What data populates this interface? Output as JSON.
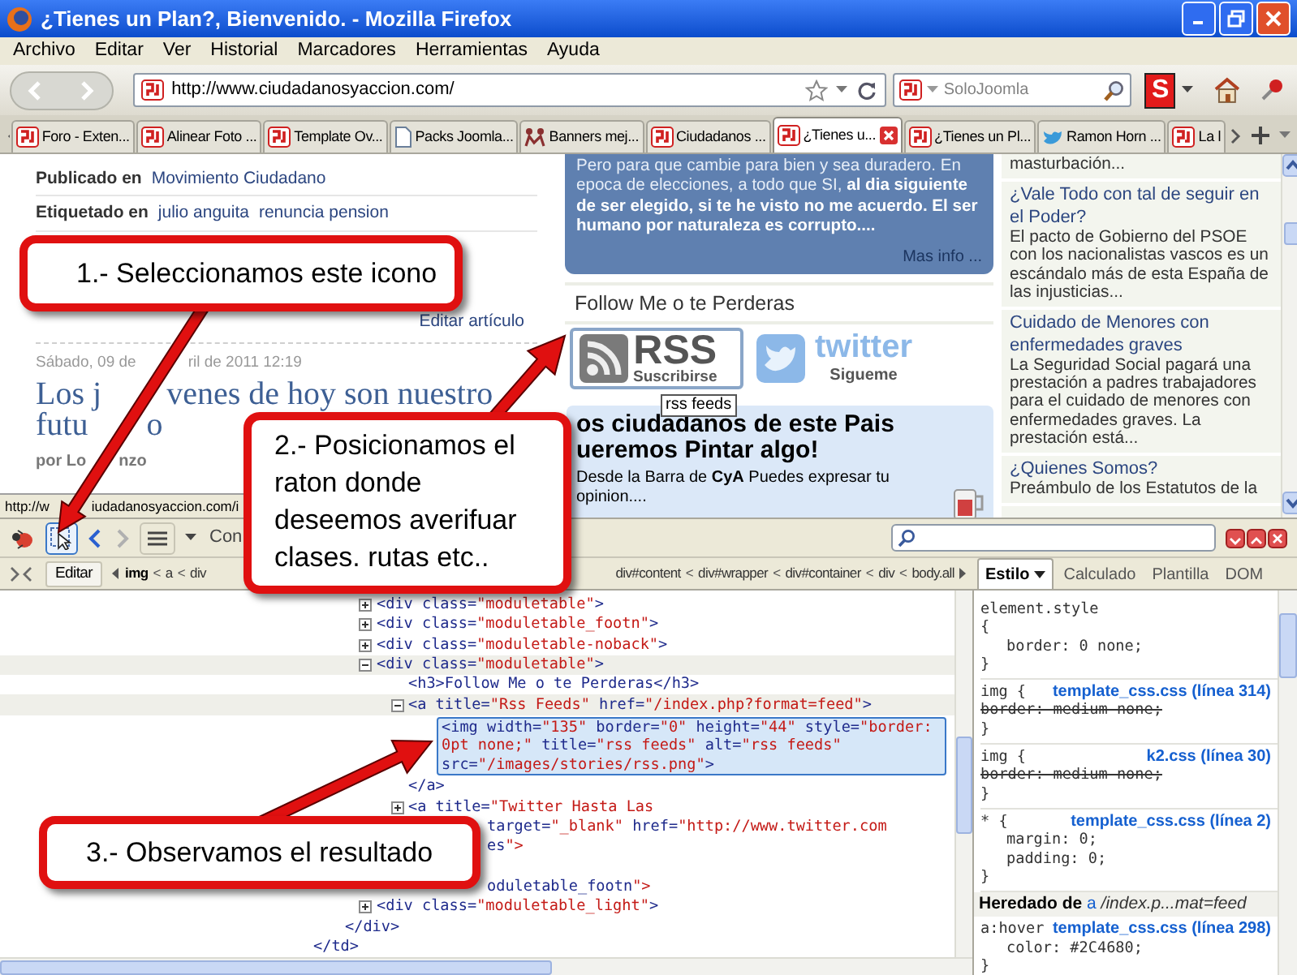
{
  "window": {
    "title": "¿Tienes un Plan?, Bienvenido. - Mozilla Firefox"
  },
  "menu": [
    "Archivo",
    "Editar",
    "Ver",
    "Historial",
    "Marcadores",
    "Herramientas",
    "Ayuda"
  ],
  "address_bar": {
    "url": "http://www.ciudadanosyaccion.com/"
  },
  "search_bar": {
    "placeholder": "SoloJoomla"
  },
  "toolbar_logo": "S",
  "tabs": [
    {
      "label": "Foro - Exten...",
      "kind": "sj",
      "selected": false
    },
    {
      "label": "Alinear Foto ...",
      "kind": "sj",
      "selected": false
    },
    {
      "label": "Template Ov...",
      "kind": "sj",
      "selected": false
    },
    {
      "label": "Packs Joomla...",
      "kind": "page",
      "selected": false
    },
    {
      "label": "Banners mej...",
      "kind": "banner",
      "selected": false
    },
    {
      "label": "Ciudadanos ...",
      "kind": "sj",
      "selected": false
    },
    {
      "label": "¿Tienes u...",
      "kind": "sj",
      "selected": true
    },
    {
      "label": "¿Tienes un Pl...",
      "kind": "sj",
      "selected": false
    },
    {
      "label": "Ramon Horn ...",
      "kind": "bird",
      "selected": false
    },
    {
      "label": "La l",
      "kind": "sj",
      "selected": false
    }
  ],
  "article": {
    "published_label": "Publicado en",
    "published_link": "Movimiento Ciudadano",
    "tags_label": "Etiquetado en",
    "tags": [
      "julio anguita",
      "renuncia pension"
    ],
    "edit_link": "Editar artículo",
    "date_parts": [
      "Sábado, 09 de",
      "ril de 2011 12:19"
    ],
    "title_lines": [
      [
        "Los j",
        "venes de hoy son nuestro"
      ],
      [
        "futu",
        "o"
      ]
    ],
    "byline_parts": [
      "por Lo",
      "nzo"
    ]
  },
  "status_parts": [
    "http://w",
    "iudadanosyaccion.com/i"
  ],
  "module": {
    "text": "Pero para que cambie para bien y sea duradero. En epoca de elecciones, a todo que SI, **al dia siguiente de ser elegido, si te he visto no me acuerdo. El ser humano por naturaleza es corrupto....**",
    "more_link": "Mas info ...",
    "follow_title": "Follow Me o te Perderas",
    "rss_label": "RSS",
    "rss_caption": "Suscribirse",
    "twitter_label": "twitter",
    "twitter_caption": "Sigueme",
    "tooltip": "rss feeds"
  },
  "promo": {
    "heading_lines": [
      "os ciudadanos de este Pais",
      "ueremos Pintar algo!"
    ],
    "text": "Desde la Barra de **CyA** Puedes expresar tu opinion...."
  },
  "sidebar_items": [
    {
      "text": "masturbación..."
    },
    {
      "title": "¿Vale Todo con tal de seguir en el Poder?",
      "text": "El pacto de Gobierno del PSOE con los nacionalistas vascos es un escándalo más de esta España de las injusticias..."
    },
    {
      "title": "Cuidado de Menores con enfermedades graves",
      "text": "La Seguridad Social pagará una prestación a padres trabajadores para el cuidado de menores con enfermedades graves. La prestación está..."
    },
    {
      "title": "¿Quienes Somos?",
      "text": "Preámbulo de los Estatutos de la"
    }
  ],
  "firebug": {
    "panel_tab": "Con",
    "edit_button": "Editar",
    "breadcrumb_left": [
      {
        "label": "img",
        "selected": true
      },
      {
        "sep": "<",
        "label": "a",
        "selected": false
      },
      {
        "sep": "<",
        "label": "div",
        "selected": false
      }
    ],
    "breadcrumb_right": [
      {
        "label": "div#content",
        "selected": false
      },
      {
        "sep": "<",
        "label": "div#wrapper",
        "selected": false
      },
      {
        "sep": "<",
        "label": "div#container",
        "selected": false
      },
      {
        "sep": "<",
        "label": "div",
        "selected": false
      },
      {
        "sep": "<",
        "label": "body.all",
        "selected": false
      }
    ],
    "side_tabs": [
      {
        "label": "Estilo",
        "has_menu": true,
        "selected": true
      },
      {
        "label": "Calculado",
        "has_menu": false,
        "selected": false
      },
      {
        "label": "Plantilla",
        "has_menu": false,
        "selected": false
      },
      {
        "label": "DOM",
        "has_menu": false,
        "selected": false
      }
    ],
    "html_tree": [
      {
        "close": "</td>",
        "children": [
          {
            "close": "</div>",
            "children": [
              {
                "text": "<div class=\"moduletable\">",
                "expanded": false,
                "selected": false
              },
              {
                "text": "<div class=\"moduletable_footn\">",
                "expanded": false,
                "selected": false
              },
              {
                "text": "<div class=\"moduletable-noback\">",
                "expanded": false,
                "selected": false
              },
              {
                "text": "<div class=\"moduletable\">",
                "expanded": true,
                "selected": false,
                "children": [
                  {
                    "text": "<h3>Follow Me o te Perderas</h3>",
                    "selected": false
                  },
                  {
                    "text": "<a title=\"Rss Feeds\" href=\"/index.php?format=feed\">",
                    "expanded": true,
                    "selected": false,
                    "close": "</a>",
                    "children": [
                      {
                        "text": "<img width=\"135\" border=\"0\" height=\"44\" style=\"border: 0pt none;\" title=\"rss feeds\" alt=\"rss feeds\" src=\"/images/stories/rss.png\">",
                        "selected": true
                      }
                    ]
                  },
                  {
                    "text": "<a title=\"Twitter Hasta Las",
                    "expanded": false,
                    "selected": false,
                    "more_lines": [
                      "target=\"_blank\" href=\"http://www.twitter.com",
                      "es\">"
                    ]
                  }
                ]
              },
              {
                "text": "oduletable_footn\">",
                "cut": true,
                "selected": false
              },
              {
                "text": "<div class=\"moduletable_light\">",
                "expanded": false,
                "selected": false
              }
            ]
          }
        ]
      }
    ],
    "styles": {
      "rules": [
        {
          "selector": "element.style",
          "open": "{",
          "properties": [
            {
              "text": "border: 0 none;",
              "overridden": false
            }
          ],
          "close": "}"
        },
        {
          "selector": "img {",
          "source": "template_css.css (línea 314)",
          "properties": [
            {
              "text": "border: medium none;",
              "overridden": true
            }
          ],
          "close": "}"
        },
        {
          "selector": "img {",
          "source": "k2.css (línea 30)",
          "properties": [
            {
              "text": "border: medium none;",
              "overridden": true
            }
          ],
          "close": "}"
        },
        {
          "selector": "* {",
          "source": "template_css.css (línea 2)",
          "properties": [
            {
              "text": "margin: 0;",
              "overridden": false
            },
            {
              "text": "padding: 0;",
              "overridden": false
            }
          ],
          "close": "}"
        }
      ],
      "inherited": {
        "label": "Heredado de",
        "element": "a",
        "path": "/index.p...mat=feed"
      },
      "inherited_rules": [
        {
          "selector": "a:hover",
          "source": "template_css.css (línea 298)",
          "properties": [
            {
              "text": "color: #2C4680;",
              "overridden": false
            }
          ],
          "close": "}"
        }
      ]
    }
  },
  "callouts": [
    {
      "text": "1.- Seleccionamos este icono"
    },
    {
      "text": "2.- Posicionamos el raton donde deseemos averifuar clases. rutas etc.."
    },
    {
      "text": "3.- Observamos el resultado"
    }
  ]
}
